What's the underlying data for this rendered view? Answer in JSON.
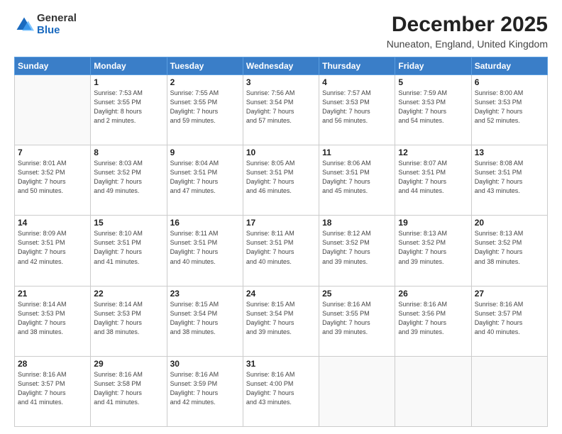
{
  "logo": {
    "general": "General",
    "blue": "Blue"
  },
  "header": {
    "title": "December 2025",
    "subtitle": "Nuneaton, England, United Kingdom"
  },
  "weekdays": [
    "Sunday",
    "Monday",
    "Tuesday",
    "Wednesday",
    "Thursday",
    "Friday",
    "Saturday"
  ],
  "weeks": [
    [
      {
        "day": "",
        "info": ""
      },
      {
        "day": "1",
        "info": "Sunrise: 7:53 AM\nSunset: 3:55 PM\nDaylight: 8 hours\nand 2 minutes."
      },
      {
        "day": "2",
        "info": "Sunrise: 7:55 AM\nSunset: 3:55 PM\nDaylight: 7 hours\nand 59 minutes."
      },
      {
        "day": "3",
        "info": "Sunrise: 7:56 AM\nSunset: 3:54 PM\nDaylight: 7 hours\nand 57 minutes."
      },
      {
        "day": "4",
        "info": "Sunrise: 7:57 AM\nSunset: 3:53 PM\nDaylight: 7 hours\nand 56 minutes."
      },
      {
        "day": "5",
        "info": "Sunrise: 7:59 AM\nSunset: 3:53 PM\nDaylight: 7 hours\nand 54 minutes."
      },
      {
        "day": "6",
        "info": "Sunrise: 8:00 AM\nSunset: 3:53 PM\nDaylight: 7 hours\nand 52 minutes."
      }
    ],
    [
      {
        "day": "7",
        "info": "Sunrise: 8:01 AM\nSunset: 3:52 PM\nDaylight: 7 hours\nand 50 minutes."
      },
      {
        "day": "8",
        "info": "Sunrise: 8:03 AM\nSunset: 3:52 PM\nDaylight: 7 hours\nand 49 minutes."
      },
      {
        "day": "9",
        "info": "Sunrise: 8:04 AM\nSunset: 3:51 PM\nDaylight: 7 hours\nand 47 minutes."
      },
      {
        "day": "10",
        "info": "Sunrise: 8:05 AM\nSunset: 3:51 PM\nDaylight: 7 hours\nand 46 minutes."
      },
      {
        "day": "11",
        "info": "Sunrise: 8:06 AM\nSunset: 3:51 PM\nDaylight: 7 hours\nand 45 minutes."
      },
      {
        "day": "12",
        "info": "Sunrise: 8:07 AM\nSunset: 3:51 PM\nDaylight: 7 hours\nand 44 minutes."
      },
      {
        "day": "13",
        "info": "Sunrise: 8:08 AM\nSunset: 3:51 PM\nDaylight: 7 hours\nand 43 minutes."
      }
    ],
    [
      {
        "day": "14",
        "info": "Sunrise: 8:09 AM\nSunset: 3:51 PM\nDaylight: 7 hours\nand 42 minutes."
      },
      {
        "day": "15",
        "info": "Sunrise: 8:10 AM\nSunset: 3:51 PM\nDaylight: 7 hours\nand 41 minutes."
      },
      {
        "day": "16",
        "info": "Sunrise: 8:11 AM\nSunset: 3:51 PM\nDaylight: 7 hours\nand 40 minutes."
      },
      {
        "day": "17",
        "info": "Sunrise: 8:11 AM\nSunset: 3:51 PM\nDaylight: 7 hours\nand 40 minutes."
      },
      {
        "day": "18",
        "info": "Sunrise: 8:12 AM\nSunset: 3:52 PM\nDaylight: 7 hours\nand 39 minutes."
      },
      {
        "day": "19",
        "info": "Sunrise: 8:13 AM\nSunset: 3:52 PM\nDaylight: 7 hours\nand 39 minutes."
      },
      {
        "day": "20",
        "info": "Sunrise: 8:13 AM\nSunset: 3:52 PM\nDaylight: 7 hours\nand 38 minutes."
      }
    ],
    [
      {
        "day": "21",
        "info": "Sunrise: 8:14 AM\nSunset: 3:53 PM\nDaylight: 7 hours\nand 38 minutes."
      },
      {
        "day": "22",
        "info": "Sunrise: 8:14 AM\nSunset: 3:53 PM\nDaylight: 7 hours\nand 38 minutes."
      },
      {
        "day": "23",
        "info": "Sunrise: 8:15 AM\nSunset: 3:54 PM\nDaylight: 7 hours\nand 38 minutes."
      },
      {
        "day": "24",
        "info": "Sunrise: 8:15 AM\nSunset: 3:54 PM\nDaylight: 7 hours\nand 39 minutes."
      },
      {
        "day": "25",
        "info": "Sunrise: 8:16 AM\nSunset: 3:55 PM\nDaylight: 7 hours\nand 39 minutes."
      },
      {
        "day": "26",
        "info": "Sunrise: 8:16 AM\nSunset: 3:56 PM\nDaylight: 7 hours\nand 39 minutes."
      },
      {
        "day": "27",
        "info": "Sunrise: 8:16 AM\nSunset: 3:57 PM\nDaylight: 7 hours\nand 40 minutes."
      }
    ],
    [
      {
        "day": "28",
        "info": "Sunrise: 8:16 AM\nSunset: 3:57 PM\nDaylight: 7 hours\nand 41 minutes."
      },
      {
        "day": "29",
        "info": "Sunrise: 8:16 AM\nSunset: 3:58 PM\nDaylight: 7 hours\nand 41 minutes."
      },
      {
        "day": "30",
        "info": "Sunrise: 8:16 AM\nSunset: 3:59 PM\nDaylight: 7 hours\nand 42 minutes."
      },
      {
        "day": "31",
        "info": "Sunrise: 8:16 AM\nSunset: 4:00 PM\nDaylight: 7 hours\nand 43 minutes."
      },
      {
        "day": "",
        "info": ""
      },
      {
        "day": "",
        "info": ""
      },
      {
        "day": "",
        "info": ""
      }
    ]
  ]
}
